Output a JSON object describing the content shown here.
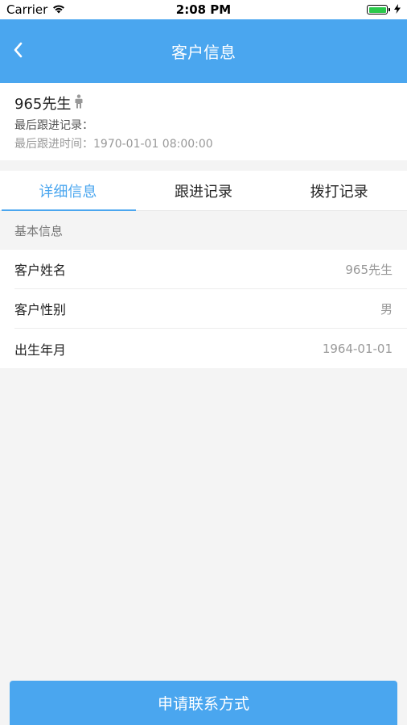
{
  "status_bar": {
    "carrier": "Carrier",
    "time": "2:08 PM",
    "battery_level": 1.0,
    "battery_color": "#2ac94b"
  },
  "nav": {
    "title": "客户信息",
    "back_icon": "chevron-left-icon",
    "background_color": "#4aa6ef"
  },
  "customer": {
    "name": "965先生",
    "gender_icon": "male-person-icon",
    "last_record_label": "最后跟进记录：",
    "last_time_label": "最后跟进时间：",
    "last_time_value": "1970-01-01 08:00:00"
  },
  "tabs": [
    {
      "label": "详细信息",
      "active": true
    },
    {
      "label": "跟进记录",
      "active": false
    },
    {
      "label": "拨打记录",
      "active": false
    }
  ],
  "section": {
    "title": "基本信息"
  },
  "info_rows": [
    {
      "label": "客户姓名",
      "value": "965先生"
    },
    {
      "label": "客户性别",
      "value": "男"
    },
    {
      "label": "出生年月",
      "value": "1964-01-01"
    }
  ],
  "apply_button": {
    "label": "申请联系方式"
  },
  "accent_color": "#4aa6ef"
}
